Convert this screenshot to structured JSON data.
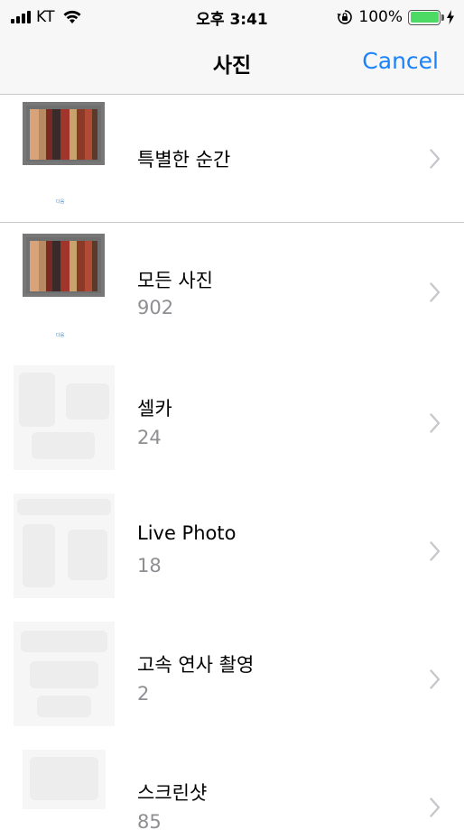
{
  "status_bar": {
    "carrier": "KT",
    "time": "오후 3:41",
    "battery_percent": "100%",
    "battery_level": 1.0,
    "icons": [
      "signal-bars-icon",
      "wifi-icon",
      "orientation-lock-icon",
      "battery-icon",
      "charging-bolt-icon"
    ]
  },
  "nav": {
    "title": "사진",
    "cancel_label": "Cancel",
    "accent_color": "#1a82fb"
  },
  "albums": [
    {
      "name": "특별한 순간",
      "count": "",
      "caption": "다음"
    },
    {
      "name": "모든 사진",
      "count": "902",
      "caption": "다음"
    },
    {
      "name": "셀카",
      "count": "24"
    },
    {
      "name": "Live Photo",
      "count": "18"
    },
    {
      "name": "고속 연사 촬영",
      "count": "2"
    },
    {
      "name": "스크린샷",
      "count": "85"
    }
  ]
}
